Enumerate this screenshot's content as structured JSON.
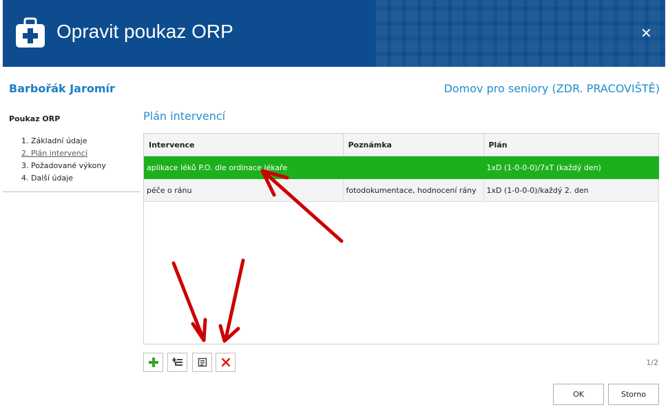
{
  "window": {
    "title": "Opravit poukaz ORP",
    "close_glyph": "✕"
  },
  "patient_name": "Barbořák Jaromír",
  "facility": "Domov pro seniory (ZDR. PRACOVIŠTĚ)",
  "sidebar": {
    "title": "Poukaz ORP",
    "items": [
      {
        "label": "1. Základní údaje",
        "active": false
      },
      {
        "label": "2. Plán intervencí",
        "active": true
      },
      {
        "label": "3. Požadované výkony",
        "active": false
      },
      {
        "label": "4. Další údaje",
        "active": false
      }
    ]
  },
  "section_title": "Plán intervencí",
  "table": {
    "columns": [
      "Intervence",
      "Poznámka",
      "Plán"
    ],
    "rows": [
      {
        "intervence": "aplikace léků P.O. dle ordinace lékaře",
        "poznamka": "",
        "plan": "1xD (1-0-0-0)/7xT (každý den)",
        "selected": true
      },
      {
        "intervence": "péče o ránu",
        "poznamka": "fotodokumentace, hodnocení rány",
        "plan": "1xD (1-0-0-0)/každý 2. den",
        "selected": false
      }
    ]
  },
  "toolbar": {
    "icons": [
      "add-icon",
      "add-child-icon",
      "edit-icon",
      "delete-icon"
    ]
  },
  "pager": "1/2",
  "buttons": {
    "ok": "OK",
    "cancel": "Storno"
  },
  "colors": {
    "header_bg": "#0d4c8e",
    "accent_blue": "#1a7fc1",
    "selected_row": "#1db01d",
    "annotation_arrow": "#cc0000"
  }
}
